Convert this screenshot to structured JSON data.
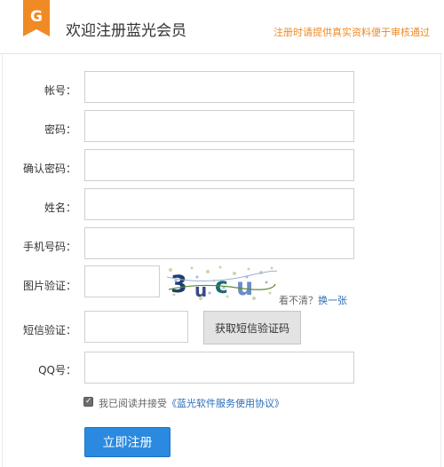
{
  "header": {
    "title": "欢迎注册蓝光会员",
    "notice": "注册时请提供真实资料便于审核通过",
    "logo_letter": "G"
  },
  "form": {
    "account_label": "帐号：",
    "password_label": "密码：",
    "confirm_password_label": "确认密码：",
    "name_label": "姓名：",
    "phone_label": "手机号码：",
    "captcha_label": "图片验证：",
    "captcha_text": "3ucu",
    "captcha_unclear": "看不清？",
    "captcha_refresh": "换一张",
    "sms_label": "短信验证：",
    "sms_button": "获取短信验证码",
    "qq_label": "QQ号：",
    "agree_prefix": "我已阅读并接受",
    "agree_link": "《蓝光软件服务使用协议》",
    "agree_checked": true,
    "submit": "立即注册"
  },
  "colors": {
    "accent_orange": "#f08a25",
    "link_blue": "#2a6db6",
    "submit_blue": "#2b8ae0"
  }
}
